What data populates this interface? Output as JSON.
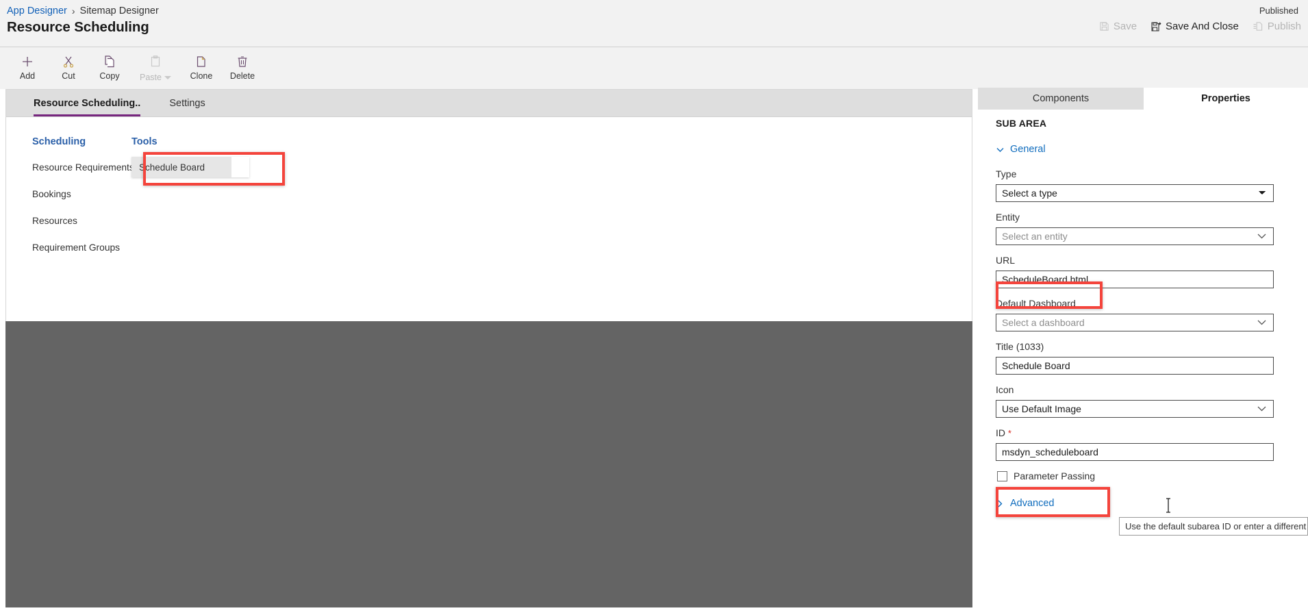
{
  "header": {
    "breadcrumb": [
      "App Designer",
      "Sitemap Designer"
    ],
    "breadcrumb_separator": "›",
    "page_title": "Resource Scheduling",
    "published_status": "Published",
    "actions": [
      {
        "label": "Save",
        "icon": "save-icon",
        "disabled": true
      },
      {
        "label": "Save And Close",
        "icon": "save-and-close-icon",
        "disabled": false
      },
      {
        "label": "Publish",
        "icon": "publish-icon",
        "disabled": true
      }
    ]
  },
  "toolbar": {
    "items": [
      {
        "label": "Add",
        "icon": "plus-icon",
        "disabled": false
      },
      {
        "label": "Cut",
        "icon": "scissors-icon",
        "disabled": false
      },
      {
        "label": "Copy",
        "icon": "copy-icon",
        "disabled": false
      },
      {
        "label": "Paste",
        "icon": "clipboard-icon",
        "disabled": true,
        "has_caret": true
      },
      {
        "label": "Clone",
        "icon": "clone-icon",
        "disabled": false
      },
      {
        "label": "Delete",
        "icon": "trash-icon",
        "disabled": false
      }
    ]
  },
  "designer": {
    "tabs": [
      {
        "label": "Resource Scheduling..",
        "active": true
      },
      {
        "label": "Settings",
        "active": false
      }
    ],
    "groups": [
      {
        "title": "Scheduling",
        "items": [
          "Resource Requirements",
          "Bookings",
          "Resources",
          "Requirement Groups"
        ]
      },
      {
        "title": "Tools",
        "items": []
      }
    ],
    "selected_tile": "Schedule Board"
  },
  "properties": {
    "tabs": [
      {
        "label": "Components",
        "active": false
      },
      {
        "label": "Properties",
        "active": true
      }
    ],
    "section_label": "SUB AREA",
    "general_section": "General",
    "advanced_section": "Advanced",
    "fields": {
      "type": {
        "label": "Type",
        "value": "Select a type",
        "control": "select"
      },
      "entity": {
        "label": "Entity",
        "value": "",
        "placeholder": "Select an entity",
        "control": "combobox"
      },
      "url": {
        "label": "URL",
        "value": "ScheduleBoard.html",
        "control": "text"
      },
      "default_dashboard": {
        "label": "Default Dashboard",
        "value": "",
        "placeholder": "Select a dashboard",
        "control": "combobox"
      },
      "title": {
        "label": "Title (1033)",
        "value": "Schedule Board",
        "control": "text"
      },
      "icon": {
        "label": "Icon",
        "value": "Use Default Image",
        "control": "combobox"
      },
      "id": {
        "label": "ID",
        "required_marker": "*",
        "value": "msdyn_scheduleboard",
        "control": "text"
      },
      "parameter_passing": {
        "label": "Parameter Passing",
        "checked": false,
        "control": "checkbox"
      }
    },
    "tooltip": "Use the default subarea ID or enter a different one."
  },
  "colors": {
    "accent_purple": "#77277e",
    "link_blue": "#0f6cbd",
    "group_heading_blue": "#2a5fa8",
    "annotation_red": "#f4443c",
    "overlay_gray": "#646464",
    "chrome_gray": "#f2f2f2"
  }
}
